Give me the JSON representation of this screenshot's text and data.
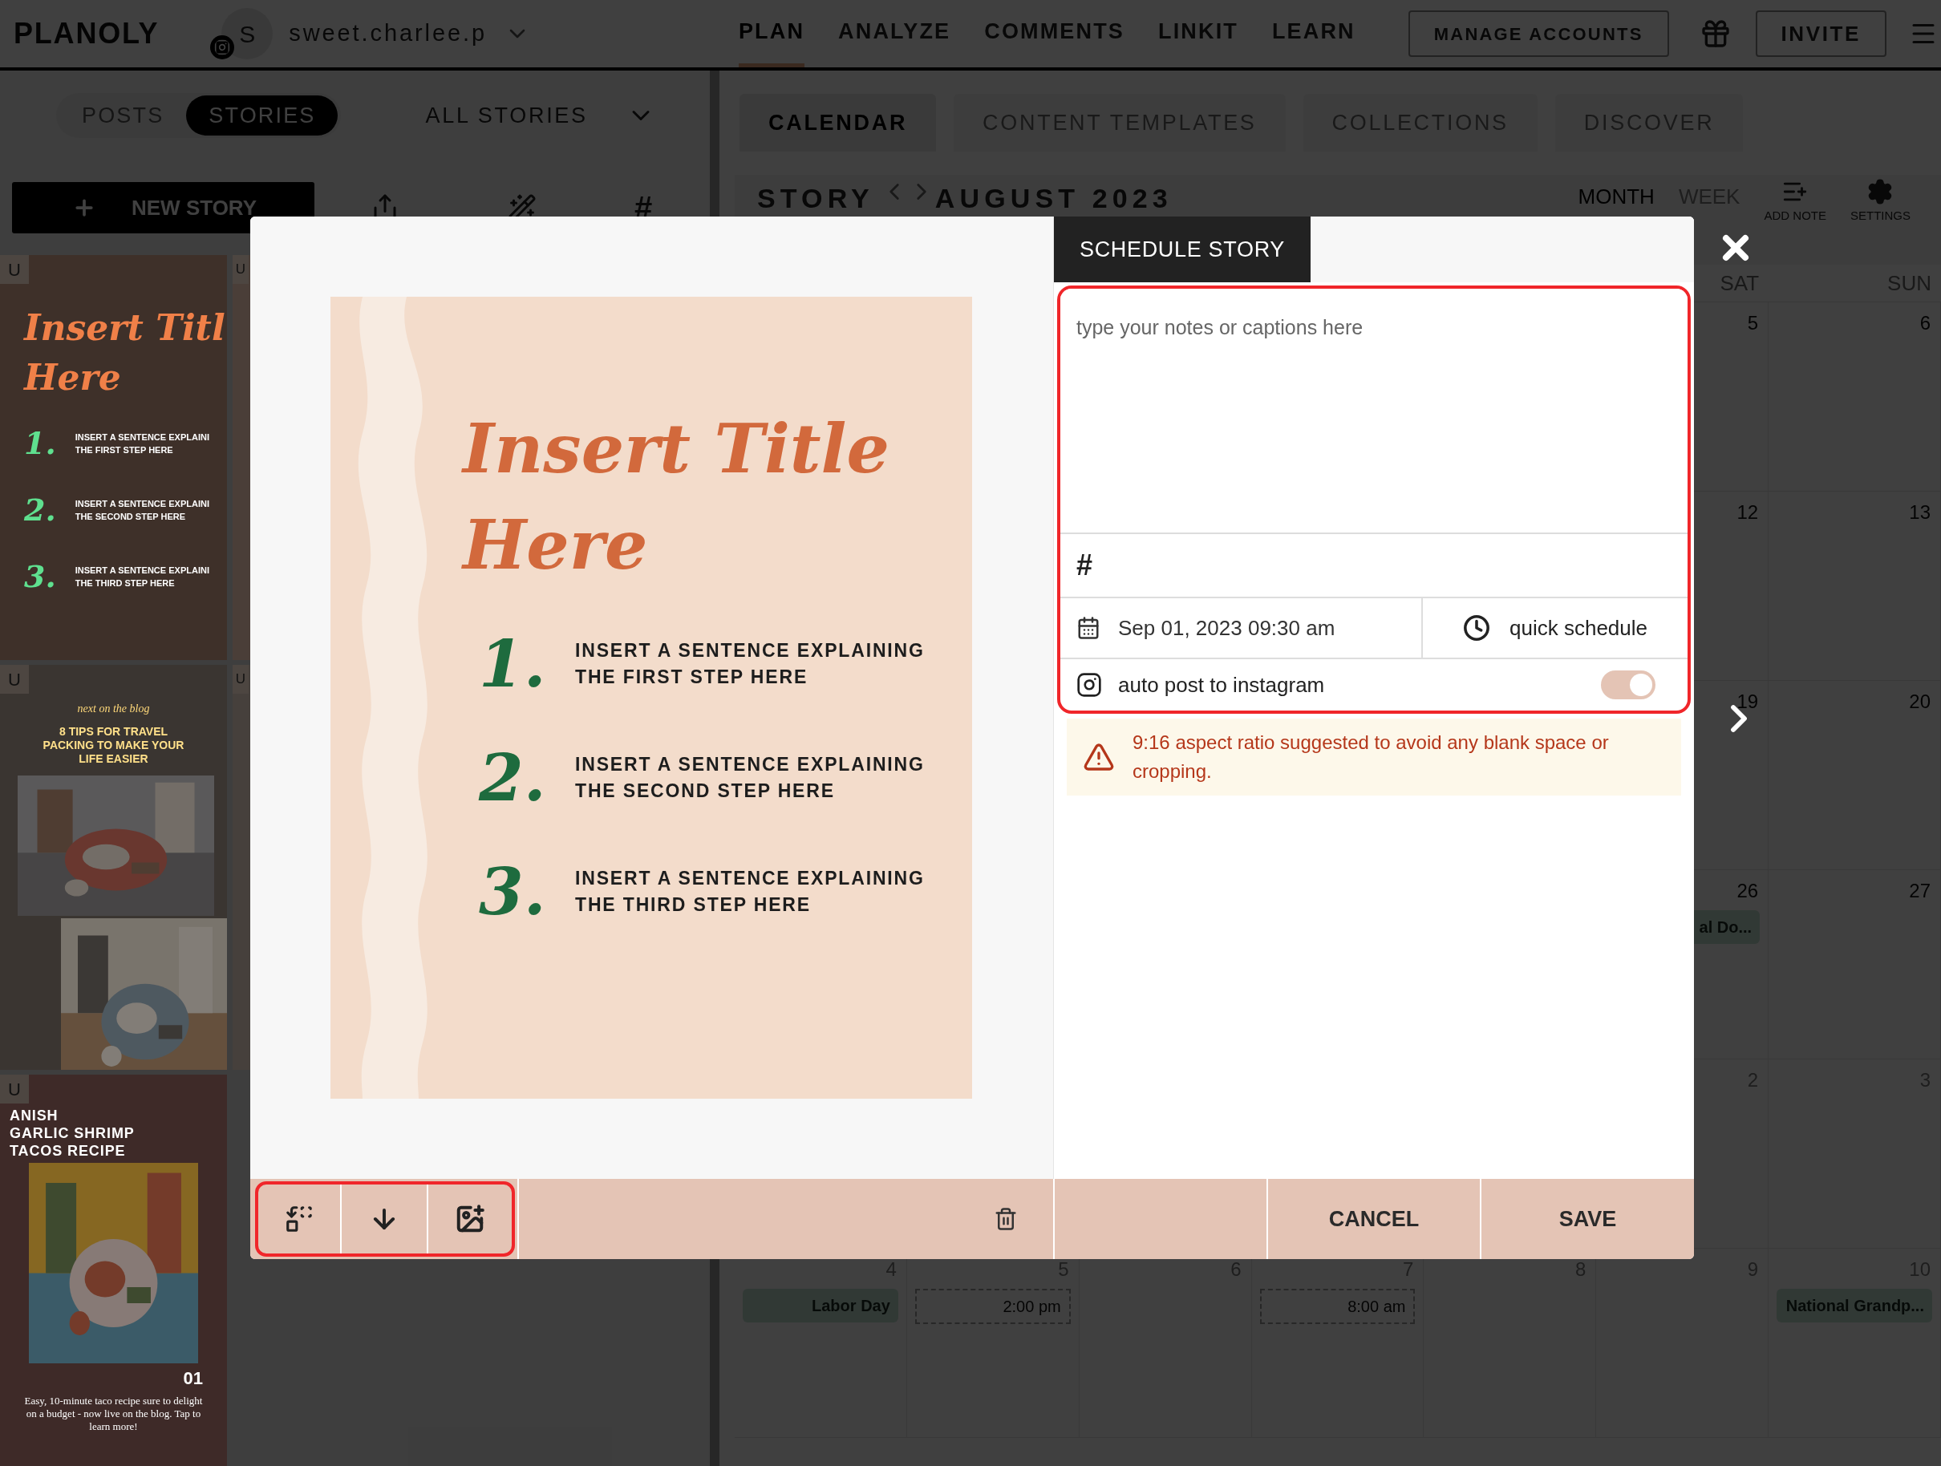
{
  "top_bar": {
    "logo": "PLANOLY",
    "account": {
      "initial": "S",
      "name": "sweet.charlee.p"
    },
    "nav": [
      {
        "label": "PLAN",
        "selected": true
      },
      {
        "label": "ANALYZE",
        "selected": false
      },
      {
        "label": "COMMENTS",
        "selected": false
      },
      {
        "label": "LINKIT",
        "selected": false
      },
      {
        "label": "LEARN",
        "selected": false
      }
    ],
    "manage_accounts": "MANAGE ACCOUNTS",
    "invite": "INVITE"
  },
  "left_panel": {
    "tabs": [
      {
        "label": "POSTS",
        "selected": false
      },
      {
        "label": "STORIES",
        "selected": true
      }
    ],
    "filter": "ALL STORIES",
    "new_story": "NEW STORY",
    "hashtag": "#",
    "stories": [
      {
        "kind": "template",
        "badge": "U",
        "title_lines": [
          "Insert Titl",
          "Here"
        ],
        "steps": [
          {
            "number": "1.",
            "lines": [
              "INSERT A SENTENCE EXPLAINI",
              "THE FIRST STEP HERE"
            ]
          },
          {
            "number": "2.",
            "lines": [
              "INSERT A SENTENCE EXPLAINI",
              "THE SECOND STEP HERE"
            ]
          },
          {
            "number": "3.",
            "lines": [
              "INSERT A SENTENCE EXPLAINI",
              "THE THIRD STEP HERE"
            ]
          }
        ]
      },
      {
        "kind": "edge",
        "badge": "U"
      },
      {
        "kind": "blog",
        "badge": "U",
        "kicker": "next on the blog",
        "title": "8 TIPS FOR TRAVEL PACKING TO MAKE YOUR LIFE EASIER"
      },
      {
        "kind": "edge",
        "badge": "U"
      },
      {
        "kind": "recipe",
        "badge": "U",
        "title_lines": [
          "ANISH",
          "GARLIC SHRIMP",
          "TACOS RECIPE"
        ],
        "number": "01",
        "caption": "Easy, 10-minute taco recipe sure to delight on a budget - now live on the blog. Tap to learn more!"
      }
    ]
  },
  "main": {
    "tabs": [
      {
        "label": "CALENDAR",
        "selected": true
      },
      {
        "label": "CONTENT TEMPLATES",
        "selected": false
      },
      {
        "label": "COLLECTIONS",
        "selected": false
      },
      {
        "label": "DISCOVER",
        "selected": false
      }
    ],
    "calendar": {
      "type": "STORY",
      "month": "AUGUST 2023",
      "views": [
        {
          "label": "MONTH",
          "selected": true
        },
        {
          "label": "WEEK",
          "selected": false
        }
      ],
      "add_note": "ADD NOTE",
      "settings": "SETTINGS",
      "day_headers": [
        "SAT",
        "SUN"
      ],
      "weeks": [
        {
          "days": [
            {
              "date": "5",
              "other_month": false
            },
            {
              "date": "6",
              "other_month": false
            }
          ]
        },
        {
          "days": [
            {
              "date": "12",
              "other_month": false
            },
            {
              "date": "13",
              "other_month": false
            }
          ]
        },
        {
          "days": [
            {
              "date": "19",
              "other_month": false
            },
            {
              "date": "20",
              "other_month": false
            }
          ]
        },
        {
          "days": [
            {
              "date": "26",
              "other_month": false,
              "events": [
                {
                  "kind": "holiday",
                  "label": "al Do..."
                }
              ]
            },
            {
              "date": "27",
              "other_month": false
            }
          ]
        },
        {
          "days": [
            {
              "date": "2",
              "other_month": true
            },
            {
              "date": "3",
              "other_month": true
            }
          ]
        },
        {
          "days": [
            {
              "date": "4",
              "other_month": true,
              "events": [
                {
                  "kind": "holiday",
                  "label": "Labor Day"
                }
              ]
            },
            {
              "date": "5",
              "other_month": true,
              "events": [
                {
                  "kind": "scheduled",
                  "label": "2:00 pm"
                }
              ]
            },
            {
              "date": "6",
              "other_month": true
            },
            {
              "date": "7",
              "other_month": true,
              "events": [
                {
                  "kind": "scheduled",
                  "label": "8:00 am"
                }
              ]
            },
            {
              "date": "8",
              "other_month": true
            },
            {
              "date": "9",
              "other_month": true
            },
            {
              "date": "10",
              "other_month": true,
              "events": [
                {
                  "kind": "holiday",
                  "label": "National Grandp..."
                }
              ]
            }
          ]
        }
      ]
    }
  },
  "modal": {
    "tab": "SCHEDULE STORY",
    "preview": {
      "title_lines": [
        "Insert Title",
        "Here"
      ],
      "steps": [
        {
          "number": "1.",
          "lines": [
            "INSERT A SENTENCE EXPLAINING",
            "THE FIRST STEP HERE"
          ]
        },
        {
          "number": "2.",
          "lines": [
            "INSERT A SENTENCE EXPLAINING",
            "THE SECOND STEP HERE"
          ]
        },
        {
          "number": "3.",
          "lines": [
            "INSERT A SENTENCE EXPLAINING",
            "THE THIRD STEP HERE"
          ]
        }
      ]
    },
    "caption": {
      "placeholder": "type your notes or captions here"
    },
    "hashtag": "#",
    "date": "Sep 01, 2023 09:30 am",
    "quick_schedule": "quick schedule",
    "auto_post": {
      "label": "auto post to instagram",
      "on": true
    },
    "warning": "9:16 aspect ratio suggested to avoid any blank space or cropping.",
    "cancel": "CANCEL",
    "save": "SAVE"
  }
}
